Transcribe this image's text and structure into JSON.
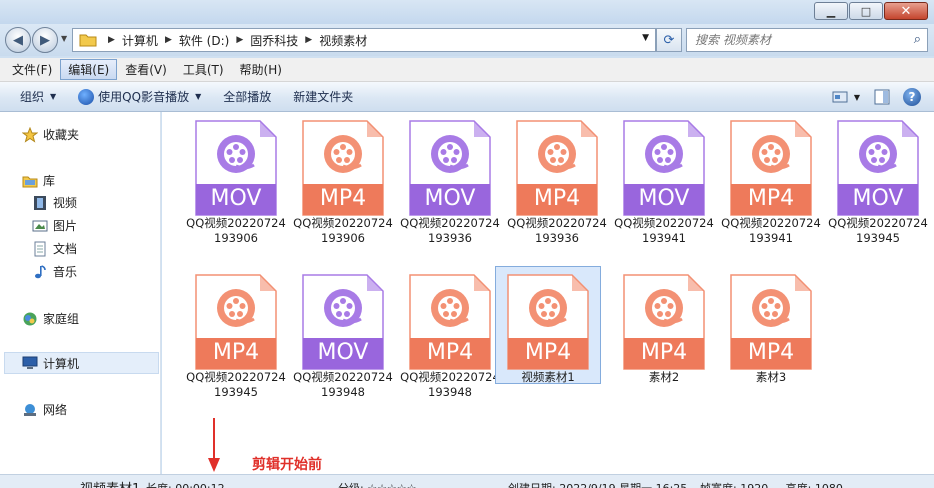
{
  "window": {
    "minimize_glyph": "▁",
    "maximize_glyph": "□",
    "close_glyph": "✕"
  },
  "address": {
    "crumbs": [
      "计算机",
      "软件 (D:)",
      "固乔科技",
      "视频素材"
    ]
  },
  "search": {
    "placeholder": "搜索 视频素材"
  },
  "menu": [
    {
      "label": "文件(F)"
    },
    {
      "label": "编辑(E)"
    },
    {
      "label": "查看(V)"
    },
    {
      "label": "工具(T)"
    },
    {
      "label": "帮助(H)"
    }
  ],
  "toolbar": {
    "organize": "组织",
    "play_with_qq": "使用QQ影音播放",
    "play_all": "全部播放",
    "new_folder": "新建文件夹"
  },
  "nav": {
    "favorites": "收藏夹",
    "libraries": "库",
    "videos": "视频",
    "pictures": "图片",
    "documents": "文档",
    "music": "音乐",
    "homegroup": "家庭组",
    "computer": "计算机",
    "network": "网络"
  },
  "files": [
    {
      "ext": "MOV",
      "name": "QQ视频20220724193906"
    },
    {
      "ext": "MP4",
      "name": "QQ视频20220724193906"
    },
    {
      "ext": "MOV",
      "name": "QQ视频20220724193936"
    },
    {
      "ext": "MP4",
      "name": "QQ视频20220724193936"
    },
    {
      "ext": "MOV",
      "name": "QQ视频20220724193941"
    },
    {
      "ext": "MP4",
      "name": "QQ视频20220724193941"
    },
    {
      "ext": "MOV",
      "name": "QQ视频20220724193945"
    },
    {
      "ext": "MP4",
      "name": "QQ视频20220724193945"
    },
    {
      "ext": "MOV",
      "name": "QQ视频20220724193948"
    },
    {
      "ext": "MP4",
      "name": "QQ视频20220724193948"
    },
    {
      "ext": "MP4",
      "name": "视频素材1"
    },
    {
      "ext": "MP4",
      "name": "素材2"
    },
    {
      "ext": "MP4",
      "name": "素材3"
    }
  ],
  "annotation": "剪辑开始前",
  "status": {
    "name": "视频素材1",
    "duration": "长度: 00:00:12",
    "rating": "分级: ☆☆☆☆☆",
    "created": "创建日期: 2022/9/19 星期一 16:25",
    "size": "帧宽度: 1920 ... 高度: 1080"
  },
  "colors": {
    "mov": "#a87be6",
    "mov_band": "#9966dd",
    "mp4": "#f39174",
    "mp4_band": "#ee7a5b",
    "annotation": "#e0302a"
  }
}
